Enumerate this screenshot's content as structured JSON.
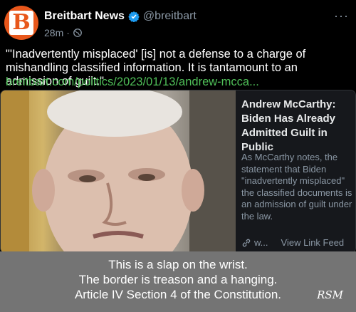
{
  "post": {
    "author": "Breitbart News",
    "handle": "@breitbart",
    "time": "28m",
    "more": "···",
    "text": "\"'Inadvertently misplaced' [is] not a defense to a charge of mishandling classified information. It is tantamount to an admission of guilt.\"",
    "link": "breitbart.com/politics/2023/01/13/andrew-mcca...",
    "avatar_letter": "B"
  },
  "card": {
    "title": "Andrew McCarthy: Biden Has Already Admitted Guilt in Public",
    "description": "As McCarthy notes, the statement that Biden \"inadvertently misplaced\" the classified documents is an admission of guilt under the law.",
    "source": "w...",
    "view_link": "View Link Feed"
  },
  "caption": {
    "lines": [
      "This is a slap on the wrist.",
      "The border is treason and a hanging.",
      "Article IV Section 4 of the Constitution."
    ],
    "signature": "RSM"
  },
  "colors": {
    "brand": "#e8571b",
    "verified": "#1d9bf0",
    "link": "#4fbf58",
    "caption_bg": "#747474"
  },
  "icons": {
    "verified": "verified-badge-icon",
    "globe": "globe-icon",
    "link": "link-chain-icon",
    "more": "more-options-icon"
  }
}
